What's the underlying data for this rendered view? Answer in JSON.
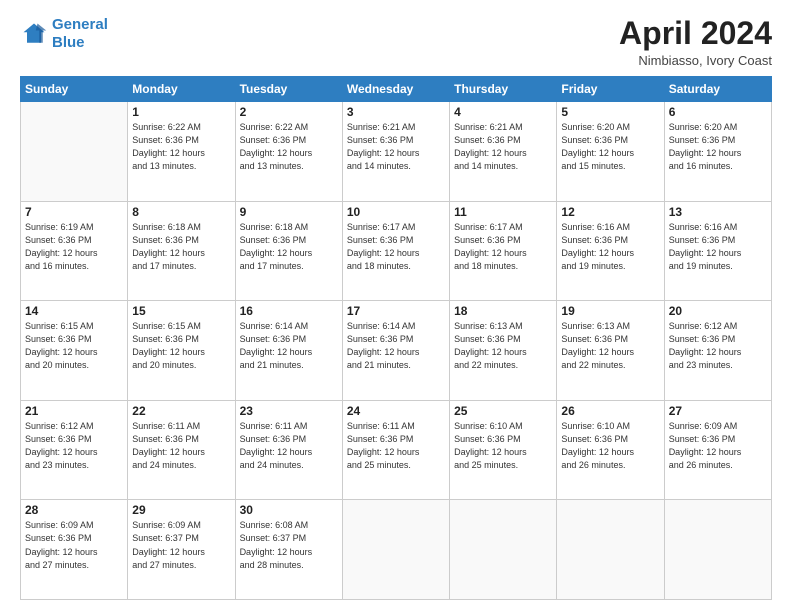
{
  "header": {
    "logo_line1": "General",
    "logo_line2": "Blue",
    "month_title": "April 2024",
    "subtitle": "Nimbiasso, Ivory Coast"
  },
  "days_of_week": [
    "Sunday",
    "Monday",
    "Tuesday",
    "Wednesday",
    "Thursday",
    "Friday",
    "Saturday"
  ],
  "weeks": [
    [
      {
        "num": "",
        "info": ""
      },
      {
        "num": "1",
        "info": "Sunrise: 6:22 AM\nSunset: 6:36 PM\nDaylight: 12 hours\nand 13 minutes."
      },
      {
        "num": "2",
        "info": "Sunrise: 6:22 AM\nSunset: 6:36 PM\nDaylight: 12 hours\nand 13 minutes."
      },
      {
        "num": "3",
        "info": "Sunrise: 6:21 AM\nSunset: 6:36 PM\nDaylight: 12 hours\nand 14 minutes."
      },
      {
        "num": "4",
        "info": "Sunrise: 6:21 AM\nSunset: 6:36 PM\nDaylight: 12 hours\nand 14 minutes."
      },
      {
        "num": "5",
        "info": "Sunrise: 6:20 AM\nSunset: 6:36 PM\nDaylight: 12 hours\nand 15 minutes."
      },
      {
        "num": "6",
        "info": "Sunrise: 6:20 AM\nSunset: 6:36 PM\nDaylight: 12 hours\nand 16 minutes."
      }
    ],
    [
      {
        "num": "7",
        "info": "Sunrise: 6:19 AM\nSunset: 6:36 PM\nDaylight: 12 hours\nand 16 minutes."
      },
      {
        "num": "8",
        "info": "Sunrise: 6:18 AM\nSunset: 6:36 PM\nDaylight: 12 hours\nand 17 minutes."
      },
      {
        "num": "9",
        "info": "Sunrise: 6:18 AM\nSunset: 6:36 PM\nDaylight: 12 hours\nand 17 minutes."
      },
      {
        "num": "10",
        "info": "Sunrise: 6:17 AM\nSunset: 6:36 PM\nDaylight: 12 hours\nand 18 minutes."
      },
      {
        "num": "11",
        "info": "Sunrise: 6:17 AM\nSunset: 6:36 PM\nDaylight: 12 hours\nand 18 minutes."
      },
      {
        "num": "12",
        "info": "Sunrise: 6:16 AM\nSunset: 6:36 PM\nDaylight: 12 hours\nand 19 minutes."
      },
      {
        "num": "13",
        "info": "Sunrise: 6:16 AM\nSunset: 6:36 PM\nDaylight: 12 hours\nand 19 minutes."
      }
    ],
    [
      {
        "num": "14",
        "info": "Sunrise: 6:15 AM\nSunset: 6:36 PM\nDaylight: 12 hours\nand 20 minutes."
      },
      {
        "num": "15",
        "info": "Sunrise: 6:15 AM\nSunset: 6:36 PM\nDaylight: 12 hours\nand 20 minutes."
      },
      {
        "num": "16",
        "info": "Sunrise: 6:14 AM\nSunset: 6:36 PM\nDaylight: 12 hours\nand 21 minutes."
      },
      {
        "num": "17",
        "info": "Sunrise: 6:14 AM\nSunset: 6:36 PM\nDaylight: 12 hours\nand 21 minutes."
      },
      {
        "num": "18",
        "info": "Sunrise: 6:13 AM\nSunset: 6:36 PM\nDaylight: 12 hours\nand 22 minutes."
      },
      {
        "num": "19",
        "info": "Sunrise: 6:13 AM\nSunset: 6:36 PM\nDaylight: 12 hours\nand 22 minutes."
      },
      {
        "num": "20",
        "info": "Sunrise: 6:12 AM\nSunset: 6:36 PM\nDaylight: 12 hours\nand 23 minutes."
      }
    ],
    [
      {
        "num": "21",
        "info": "Sunrise: 6:12 AM\nSunset: 6:36 PM\nDaylight: 12 hours\nand 23 minutes."
      },
      {
        "num": "22",
        "info": "Sunrise: 6:11 AM\nSunset: 6:36 PM\nDaylight: 12 hours\nand 24 minutes."
      },
      {
        "num": "23",
        "info": "Sunrise: 6:11 AM\nSunset: 6:36 PM\nDaylight: 12 hours\nand 24 minutes."
      },
      {
        "num": "24",
        "info": "Sunrise: 6:11 AM\nSunset: 6:36 PM\nDaylight: 12 hours\nand 25 minutes."
      },
      {
        "num": "25",
        "info": "Sunrise: 6:10 AM\nSunset: 6:36 PM\nDaylight: 12 hours\nand 25 minutes."
      },
      {
        "num": "26",
        "info": "Sunrise: 6:10 AM\nSunset: 6:36 PM\nDaylight: 12 hours\nand 26 minutes."
      },
      {
        "num": "27",
        "info": "Sunrise: 6:09 AM\nSunset: 6:36 PM\nDaylight: 12 hours\nand 26 minutes."
      }
    ],
    [
      {
        "num": "28",
        "info": "Sunrise: 6:09 AM\nSunset: 6:36 PM\nDaylight: 12 hours\nand 27 minutes."
      },
      {
        "num": "29",
        "info": "Sunrise: 6:09 AM\nSunset: 6:37 PM\nDaylight: 12 hours\nand 27 minutes."
      },
      {
        "num": "30",
        "info": "Sunrise: 6:08 AM\nSunset: 6:37 PM\nDaylight: 12 hours\nand 28 minutes."
      },
      {
        "num": "",
        "info": ""
      },
      {
        "num": "",
        "info": ""
      },
      {
        "num": "",
        "info": ""
      },
      {
        "num": "",
        "info": ""
      }
    ]
  ]
}
